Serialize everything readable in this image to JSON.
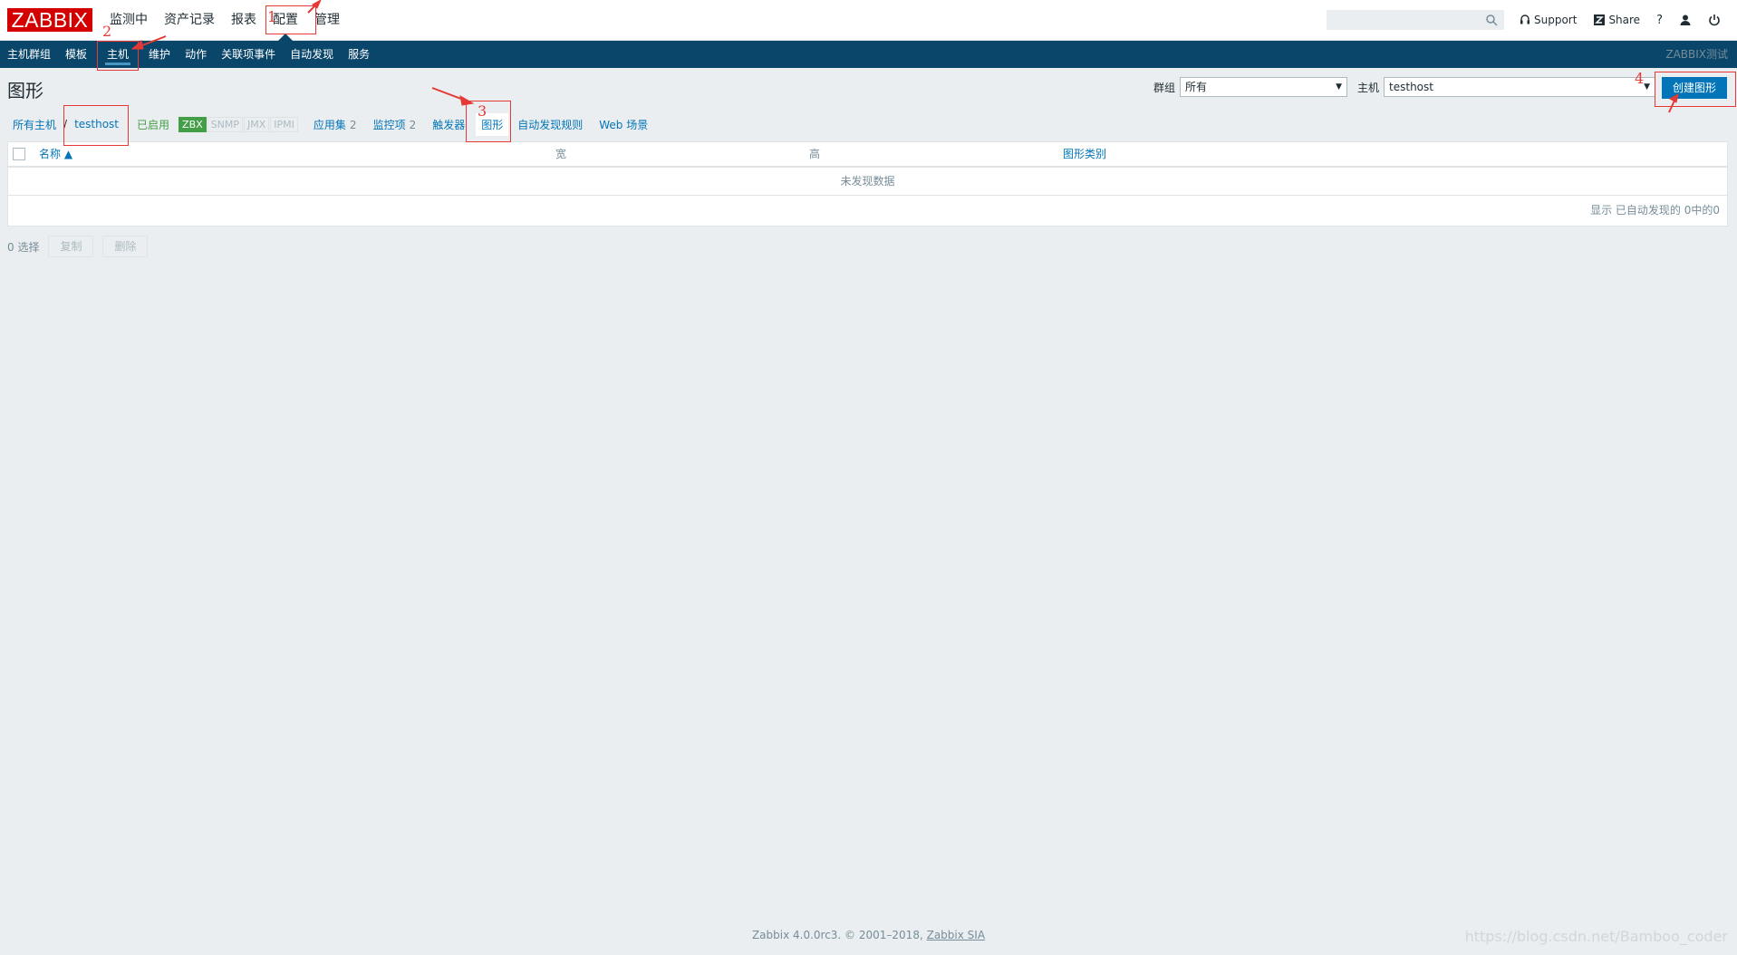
{
  "topbar": {
    "logo": "ZABBIX",
    "menu": [
      "监测中",
      "资产记录",
      "报表",
      "配置",
      "管理"
    ],
    "support": "Support",
    "share": "Share",
    "help": "?"
  },
  "submenu": {
    "items": [
      "主机群组",
      "模板",
      "主机",
      "维护",
      "动作",
      "关联项事件",
      "自动发现",
      "服务"
    ],
    "brand": "ZABBIX测试"
  },
  "page": {
    "title": "图形",
    "group_label": "群组",
    "group_value": "所有",
    "host_label": "主机",
    "host_value": "testhost",
    "create_button": "创建图形"
  },
  "breadcrumb": {
    "all_hosts": "所有主机",
    "separator": "/",
    "host": "testhost",
    "status": "已启用",
    "tags": [
      "ZBX",
      "SNMP",
      "JMX",
      "IPMI"
    ],
    "applications": "应用集",
    "applications_count": "2",
    "items": "监控项",
    "items_count": "2",
    "triggers": "触发器",
    "graphs": "图形",
    "discovery": "自动发现规则",
    "web": "Web 场景"
  },
  "table": {
    "columns": [
      "名称 ▲",
      "宽",
      "高",
      "图形类别"
    ],
    "empty_text": "未发现数据",
    "paging_text": "显示 已自动发现的 0中的0"
  },
  "actions": {
    "selected": "0 选择",
    "copy": "复制",
    "delete": "删除"
  },
  "footer": {
    "text": "Zabbix 4.0.0rc3. © 2001–2018,",
    "company": "Zabbix SIA",
    "watermark": "https://blog.csdn.net/Bamboo_coder"
  },
  "annotations": [
    "1",
    "2",
    "3",
    "4"
  ],
  "colors": {
    "accent": "#0275b8",
    "nav": "#0a466a",
    "logo": "#d40000",
    "annotation": "#e53935"
  }
}
